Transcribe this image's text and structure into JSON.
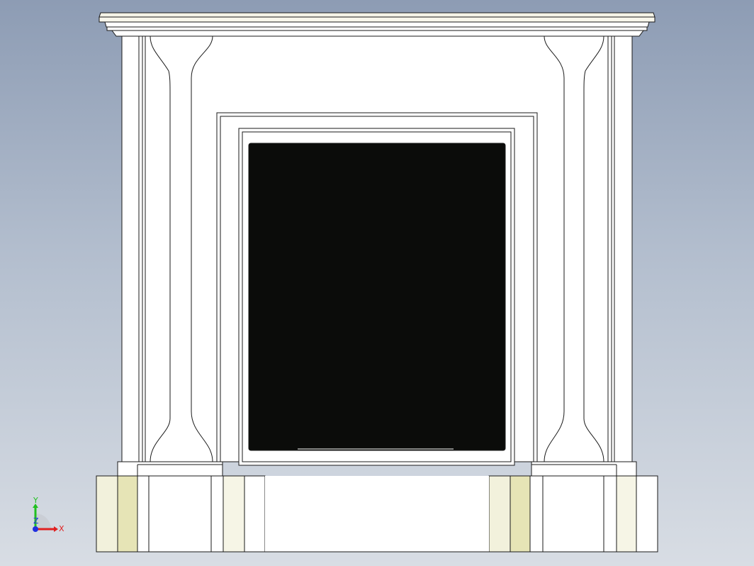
{
  "view": {
    "background_top": "#8d9cb4",
    "background_bottom": "#d8dde4",
    "model_face": "#ffffff",
    "model_edge": "#1a1a1a",
    "firebox_fill": "#0b0c0a",
    "shade_tint": "#ecebc8"
  },
  "triad": {
    "x_label": "X",
    "y_label": "Y",
    "z_label": "Z",
    "x_color": "#e02020",
    "y_color": "#20c020",
    "z_color": "#2030e0"
  }
}
